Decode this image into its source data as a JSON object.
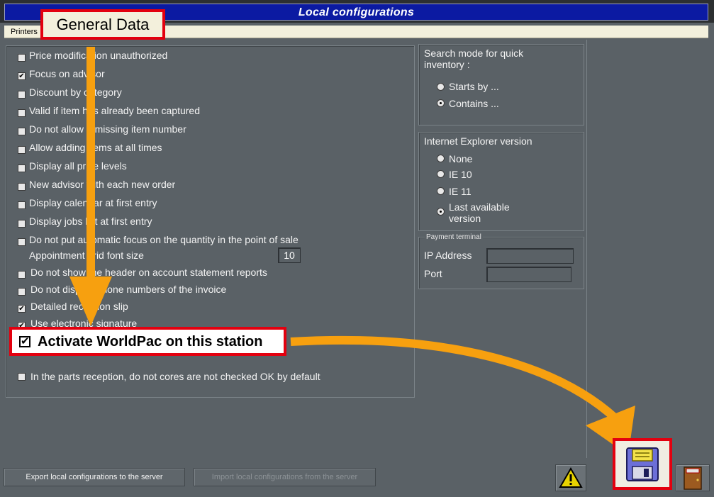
{
  "window": {
    "title": "Local configurations"
  },
  "tabs": [
    {
      "label": "Printers"
    },
    {
      "label": "General Data"
    }
  ],
  "options": [
    {
      "label": "Price modification unauthorized",
      "checked": false
    },
    {
      "label": "Focus on advisor",
      "checked": true
    },
    {
      "label": "Discount by category",
      "checked": false
    },
    {
      "label": "Valid if item has already been captured",
      "checked": false
    },
    {
      "label": "Do not allow a missing item number",
      "checked": false
    },
    {
      "label": "Allow adding items at all times",
      "checked": false
    },
    {
      "label": "Display all price levels",
      "checked": false
    },
    {
      "label": "New advisor with each new order",
      "checked": false
    },
    {
      "label": "Display calendar at first entry",
      "checked": false
    },
    {
      "label": "Display jobs list at first entry",
      "checked": false
    },
    {
      "label": "Do not put automatic focus on the quantity in the point of sale",
      "checked": false
    }
  ],
  "font_size": {
    "label": "Appointment grid font size",
    "value": "10"
  },
  "options2": [
    {
      "label": "Do not show the header on account statement reports",
      "checked": false
    },
    {
      "label": "Do not display phone numbers of the invoice",
      "checked": false
    },
    {
      "label": "Detailed reception slip",
      "checked": true
    },
    {
      "label": "Use electronic signature",
      "checked": true
    }
  ],
  "worldpac": {
    "label": "Activate WorldPac on this station",
    "checked": true
  },
  "parts_reception": {
    "label": "In the parts reception, do not cores are not checked OK by default",
    "checked": false
  },
  "search_mode": {
    "title": "Search mode for quick inventory :",
    "options": [
      {
        "label": "Starts by ...",
        "selected": false
      },
      {
        "label": "Contains ...",
        "selected": true
      }
    ]
  },
  "ie_version": {
    "title": "Internet Explorer version",
    "options": [
      {
        "label": "None",
        "selected": false
      },
      {
        "label": "IE 10",
        "selected": false
      },
      {
        "label": "IE 11",
        "selected": false
      },
      {
        "label": "Last available version",
        "selected": true
      }
    ]
  },
  "payment_terminal": {
    "title": "Payment terminal",
    "ip_label": "IP Address",
    "ip_value": "",
    "port_label": "Port",
    "port_value": ""
  },
  "footer": {
    "export_label": "Export local configurations to the server",
    "import_label": "Import local configurations from the server"
  },
  "colors": {
    "title_bar": "#0b1aa2",
    "background": "#5a6166",
    "highlight": "#e3000f",
    "arrow": "#f7a00f"
  },
  "icons": {
    "warning": "warning-icon",
    "save": "floppy-disk-icon",
    "exit": "exit-door-icon"
  }
}
